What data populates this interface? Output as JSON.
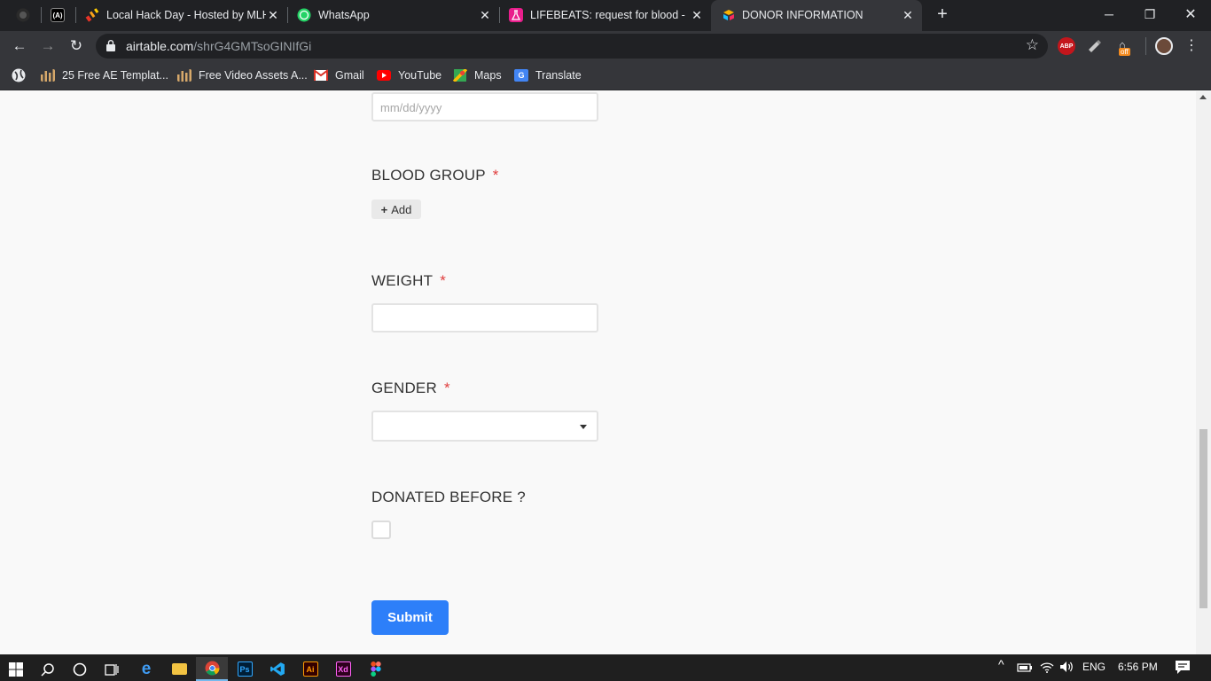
{
  "browser": {
    "tabs": [
      {
        "label": "",
        "favicon": "github-icon"
      },
      {
        "label": "",
        "favicon": "devto-icon"
      },
      {
        "label": "Local Hack Day - Hosted by MLH",
        "favicon": "mlh-icon"
      },
      {
        "label": "WhatsApp",
        "favicon": "whatsapp-icon"
      },
      {
        "label": "LIFEBEATS: request for blood - Ai",
        "favicon": "flask-icon"
      },
      {
        "label": "DONOR INFORMATION",
        "favicon": "airtable-icon"
      }
    ],
    "new_tab": "+",
    "url_host": "airtable.com",
    "url_path": "/shrG4GMTsoGINIfGi",
    "bookmarks": [
      {
        "label": "25 Free AE Templat...",
        "icon": "chart-bars-icon"
      },
      {
        "label": "Free Video Assets A...",
        "icon": "chart-bars-icon"
      },
      {
        "label": "Gmail",
        "icon": "gmail-icon"
      },
      {
        "label": "YouTube",
        "icon": "youtube-icon"
      },
      {
        "label": "Maps",
        "icon": "maps-icon"
      },
      {
        "label": "Translate",
        "icon": "translate-icon"
      }
    ],
    "extensions": {
      "abp": "ABP",
      "off": "off"
    }
  },
  "form": {
    "date_placeholder": "mm/dd/yyyy",
    "blood_group": {
      "label": "BLOOD GROUP",
      "required": "*",
      "add_label": "Add"
    },
    "weight": {
      "label": "WEIGHT",
      "required": "*",
      "value": ""
    },
    "gender": {
      "label": "GENDER",
      "required": "*",
      "selected": ""
    },
    "donated_before": {
      "label": "DONATED BEFORE ?"
    },
    "submit_label": "Submit"
  },
  "taskbar": {
    "apps": [
      "windows-start-icon",
      "search-icon",
      "cortana-icon",
      "task-view-icon",
      "edge-icon",
      "file-explorer-icon",
      "chrome-icon",
      "photoshop-icon",
      "vscode-icon",
      "illustrator-icon",
      "xd-icon",
      "figma-icon"
    ],
    "ps_label": "Ps",
    "ai_label": "Ai",
    "xd_label": "Xd",
    "language": "ENG",
    "time": "6:56 PM"
  },
  "colors": {
    "accent": "#2d7ff9",
    "required": "#e03e3e",
    "chrome_dark": "#202124",
    "chrome_mid": "#35363a"
  }
}
